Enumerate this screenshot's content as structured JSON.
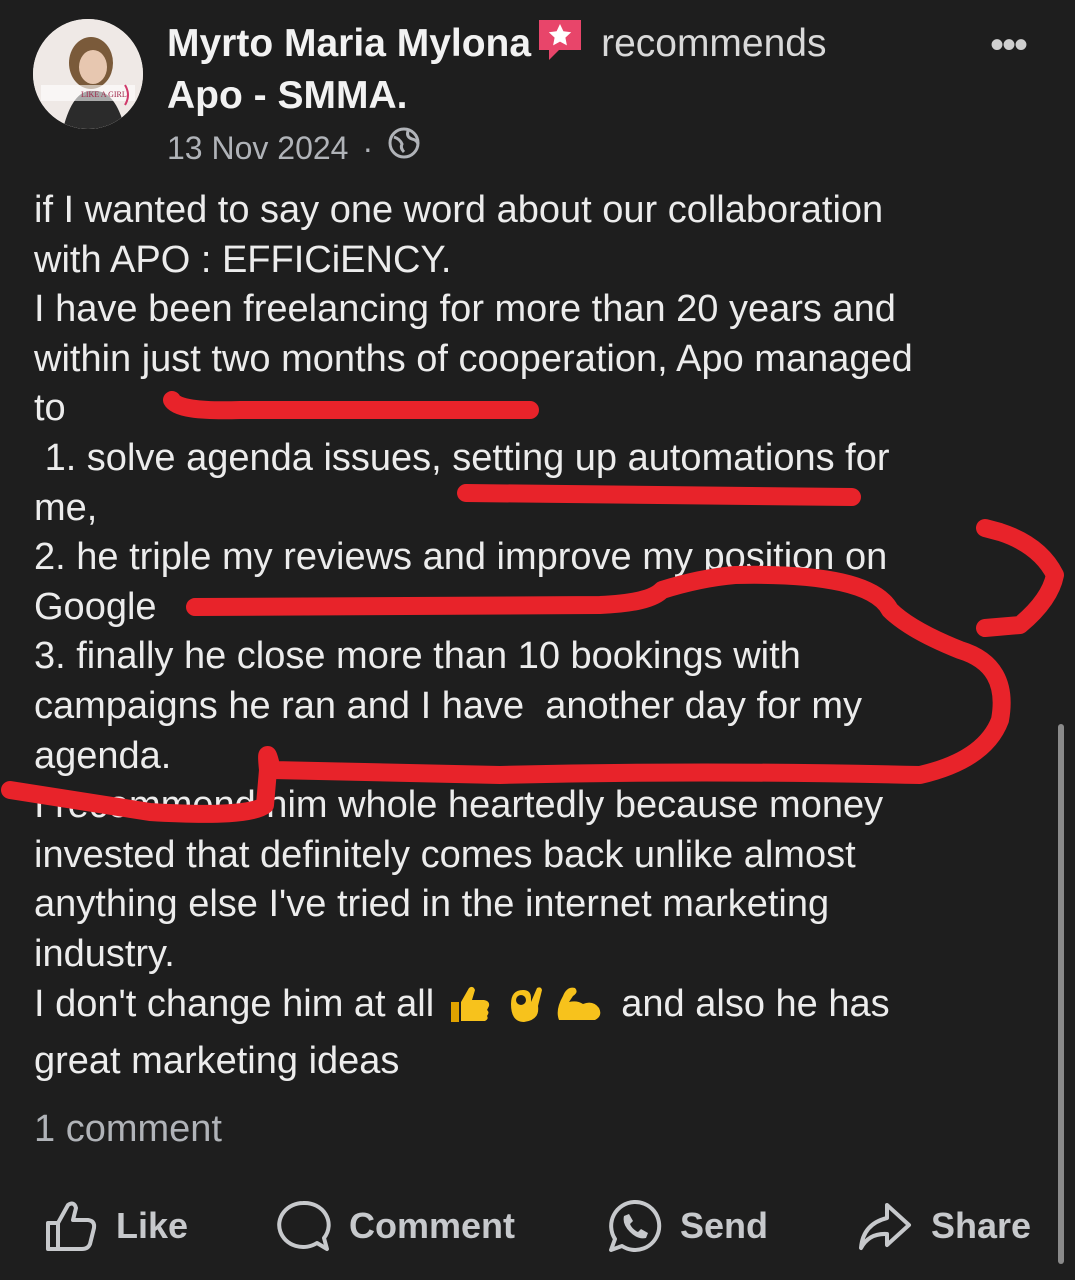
{
  "post": {
    "author": "Myrto Maria Mylona",
    "verb": "recommends",
    "page_name": "Apo - SMMA.",
    "date": "13 Nov 2024",
    "separator": "·",
    "more_label": "•••",
    "lines": [
      "if I wanted to say one word about our collaboration",
      "with APO : EFFICiENCY.",
      "I have been freelancing for more than 20 years and",
      "within just two months of cooperation, Apo managed",
      "to",
      " 1. solve agenda issues, setting up automations for",
      "me,",
      "2. he triple my reviews and improve my position on",
      "Google",
      "3. finally he close more than 10 bookings with",
      "campaigns he ran and I have  another day for my",
      "agenda.",
      "I recommend him whole heartedly because money",
      "invested that definitely comes back unlike almost",
      "anything else I've tried in the internet marketing",
      "industry."
    ],
    "last_line_start": "I don't change him at all",
    "last_line_end": " and also he has",
    "final_line": "great marketing ideas",
    "emojis": [
      "thumbs-up",
      "ok-hand",
      "flexed-biceps"
    ],
    "avatar_text": "LIKE A GIRL",
    "comments_label": "1 comment"
  },
  "actions": {
    "like": "Like",
    "comment": "Comment",
    "send": "Send",
    "share": "Share"
  },
  "colors": {
    "background": "#1e1e1e",
    "annotation": "#e8232a",
    "badge": "#e8456a"
  }
}
